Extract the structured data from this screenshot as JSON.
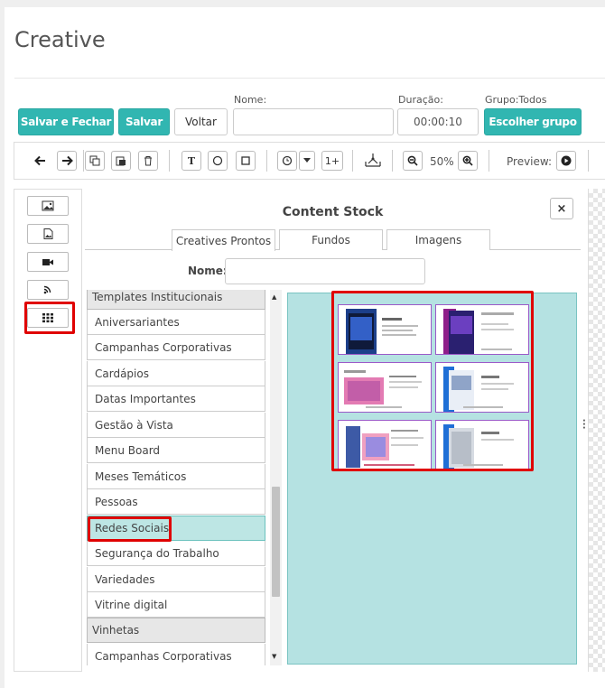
{
  "page": {
    "title": "Creative"
  },
  "form": {
    "nome_label": "Nome:",
    "nome_value": "",
    "duracao_label": "Duração:",
    "duracao_value": "00:00:10",
    "grupo_label": "Grupo:Todos",
    "btn_salvar_fechar": "Salvar e Fechar",
    "btn_salvar": "Salvar",
    "btn_voltar": "Voltar",
    "btn_escolher_grupo": "Escolher grupo"
  },
  "toolbar": {
    "text_tool": "T",
    "layer_counter": "1+",
    "zoom_level": "50%",
    "preview_label": "Preview:"
  },
  "sidebar": {
    "buttons": [
      "image-icon",
      "image-file-icon",
      "video-icon",
      "rss-icon",
      "grid-icon"
    ]
  },
  "content_stock": {
    "title": "Content Stock",
    "close_label": "×",
    "tabs": [
      "Creatives Prontos",
      "Fundos",
      "Imagens"
    ],
    "name_label": "Nome:",
    "name_value": "",
    "items": [
      {
        "label": "Templates Institucionais",
        "group": true
      },
      {
        "label": "Aniversariantes"
      },
      {
        "label": "Campanhas Corporativas"
      },
      {
        "label": "Cardápios"
      },
      {
        "label": "Datas Importantes"
      },
      {
        "label": "Gestão à Vista"
      },
      {
        "label": "Menu Board"
      },
      {
        "label": "Meses Temáticos"
      },
      {
        "label": "Pessoas"
      },
      {
        "label": "Redes Sociais",
        "selected": true
      },
      {
        "label": "Segurança do Trabalho"
      },
      {
        "label": "Variedades"
      },
      {
        "label": "Vitrine digital"
      },
      {
        "label": "Vinhetas",
        "group": true
      },
      {
        "label": "Campanhas Corporativas"
      }
    ],
    "thumbnail_count": 6
  },
  "colors": {
    "accent": "#31b6b1",
    "highlight": "#e00000",
    "selected_item": "#bde6e4",
    "thumbnail_area": "#b5e2e2",
    "thumbnail_border": "#9b59c8"
  }
}
